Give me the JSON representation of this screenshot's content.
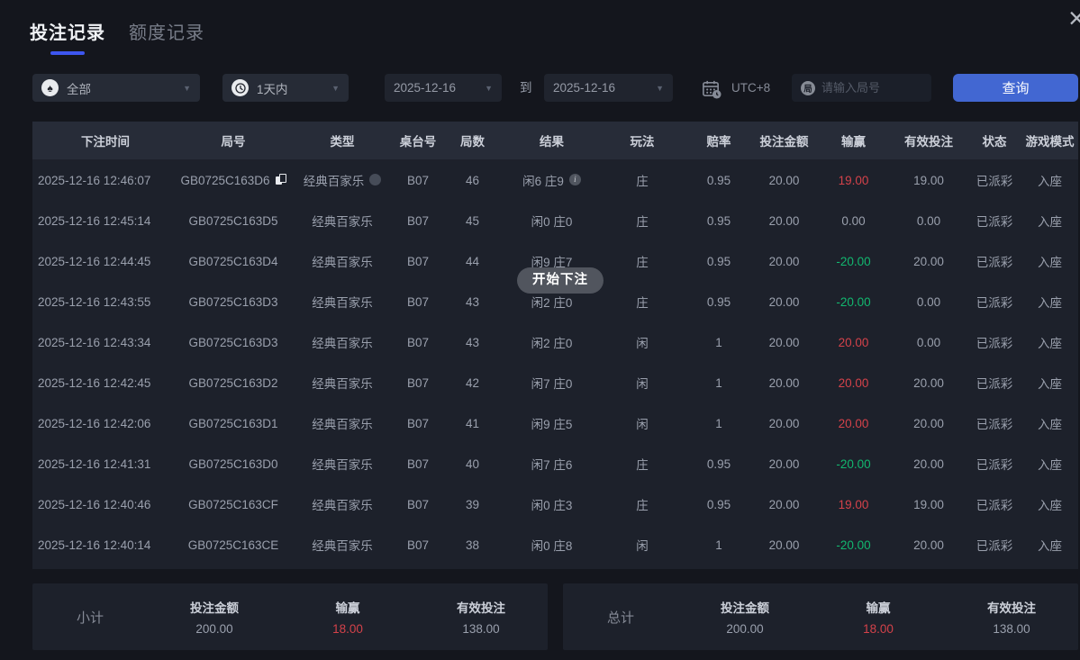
{
  "window": {
    "close_icon": "×"
  },
  "tabs": [
    {
      "label": "投注记录",
      "active": true
    },
    {
      "label": "额度记录",
      "active": false
    }
  ],
  "filters": {
    "game_type": {
      "icon": "spade-icon",
      "value": "全部"
    },
    "time_range": {
      "icon": "clock-icon",
      "value": "1天内"
    },
    "date_from": "2025-12-16",
    "to_label": "到",
    "date_to": "2025-12-16",
    "timezone_label": "UTC+8",
    "round_input": {
      "icon_text": "局",
      "placeholder": "请输入局号",
      "value": ""
    },
    "query_button": "查询"
  },
  "toast": {
    "message": "开始下注"
  },
  "table": {
    "headers": [
      "下注时间",
      "局号",
      "类型",
      "桌台号",
      "局数",
      "结果",
      "玩法",
      "赔率",
      "投注金额",
      "输赢",
      "有效投注",
      "状态",
      "游戏模式"
    ],
    "rows": [
      {
        "time": "2025-12-16 12:46:07",
        "round_id": "GB0725C163D6",
        "game_type": "经典百家乐",
        "table_no": "B07",
        "round_no": "46",
        "result": "闲6 庄9",
        "play": "庄",
        "odds": "0.95",
        "bet_amount": "20.00",
        "win_loss": "19.00",
        "win_loss_color": "red",
        "valid_bet": "19.00",
        "status": "已派彩",
        "mode": "入座",
        "show_icons": true
      },
      {
        "time": "2025-12-16 12:45:14",
        "round_id": "GB0725C163D5",
        "game_type": "经典百家乐",
        "table_no": "B07",
        "round_no": "45",
        "result": "闲0 庄0",
        "play": "庄",
        "odds": "0.95",
        "bet_amount": "20.00",
        "win_loss": "0.00",
        "win_loss_color": "normal",
        "valid_bet": "0.00",
        "status": "已派彩",
        "mode": "入座",
        "show_icons": false
      },
      {
        "time": "2025-12-16 12:44:45",
        "round_id": "GB0725C163D4",
        "game_type": "经典百家乐",
        "table_no": "B07",
        "round_no": "44",
        "result": "闲9 庄7",
        "play": "庄",
        "odds": "0.95",
        "bet_amount": "20.00",
        "win_loss": "-20.00",
        "win_loss_color": "green",
        "valid_bet": "20.00",
        "status": "已派彩",
        "mode": "入座",
        "show_icons": false
      },
      {
        "time": "2025-12-16 12:43:55",
        "round_id": "GB0725C163D3",
        "game_type": "经典百家乐",
        "table_no": "B07",
        "round_no": "43",
        "result": "闲2 庄0",
        "play": "庄",
        "odds": "0.95",
        "bet_amount": "20.00",
        "win_loss": "-20.00",
        "win_loss_color": "green",
        "valid_bet": "0.00",
        "status": "已派彩",
        "mode": "入座",
        "show_icons": false
      },
      {
        "time": "2025-12-16 12:43:34",
        "round_id": "GB0725C163D3",
        "game_type": "经典百家乐",
        "table_no": "B07",
        "round_no": "43",
        "result": "闲2 庄0",
        "play": "闲",
        "odds": "1",
        "bet_amount": "20.00",
        "win_loss": "20.00",
        "win_loss_color": "red",
        "valid_bet": "0.00",
        "status": "已派彩",
        "mode": "入座",
        "show_icons": false
      },
      {
        "time": "2025-12-16 12:42:45",
        "round_id": "GB0725C163D2",
        "game_type": "经典百家乐",
        "table_no": "B07",
        "round_no": "42",
        "result": "闲7 庄0",
        "play": "闲",
        "odds": "1",
        "bet_amount": "20.00",
        "win_loss": "20.00",
        "win_loss_color": "red",
        "valid_bet": "20.00",
        "status": "已派彩",
        "mode": "入座",
        "show_icons": false
      },
      {
        "time": "2025-12-16 12:42:06",
        "round_id": "GB0725C163D1",
        "game_type": "经典百家乐",
        "table_no": "B07",
        "round_no": "41",
        "result": "闲9 庄5",
        "play": "闲",
        "odds": "1",
        "bet_amount": "20.00",
        "win_loss": "20.00",
        "win_loss_color": "red",
        "valid_bet": "20.00",
        "status": "已派彩",
        "mode": "入座",
        "show_icons": false
      },
      {
        "time": "2025-12-16 12:41:31",
        "round_id": "GB0725C163D0",
        "game_type": "经典百家乐",
        "table_no": "B07",
        "round_no": "40",
        "result": "闲7 庄6",
        "play": "庄",
        "odds": "0.95",
        "bet_amount": "20.00",
        "win_loss": "-20.00",
        "win_loss_color": "green",
        "valid_bet": "20.00",
        "status": "已派彩",
        "mode": "入座",
        "show_icons": false
      },
      {
        "time": "2025-12-16 12:40:46",
        "round_id": "GB0725C163CF",
        "game_type": "经典百家乐",
        "table_no": "B07",
        "round_no": "39",
        "result": "闲0 庄3",
        "play": "庄",
        "odds": "0.95",
        "bet_amount": "20.00",
        "win_loss": "19.00",
        "win_loss_color": "red",
        "valid_bet": "19.00",
        "status": "已派彩",
        "mode": "入座",
        "show_icons": false
      },
      {
        "time": "2025-12-16 12:40:14",
        "round_id": "GB0725C163CE",
        "game_type": "经典百家乐",
        "table_no": "B07",
        "round_no": "38",
        "result": "闲0 庄8",
        "play": "闲",
        "odds": "1",
        "bet_amount": "20.00",
        "win_loss": "-20.00",
        "win_loss_color": "green",
        "valid_bet": "20.00",
        "status": "已派彩",
        "mode": "入座",
        "show_icons": false
      }
    ]
  },
  "summary": {
    "subtotal": {
      "title": "小计",
      "bet_label": "投注金额",
      "bet": "200.00",
      "winloss_label": "输赢",
      "winloss": "18.00",
      "valid_label": "有效投注",
      "valid": "138.00"
    },
    "total": {
      "title": "总计",
      "bet_label": "投注金额",
      "bet": "200.00",
      "winloss_label": "输赢",
      "winloss": "18.00",
      "valid_label": "有效投注",
      "valid": "138.00"
    }
  },
  "colors": {
    "accent_blue": "#4267d2",
    "tab_underline": "#3d56f0",
    "win_red": "#d4424a",
    "loss_green": "#12b76f"
  }
}
